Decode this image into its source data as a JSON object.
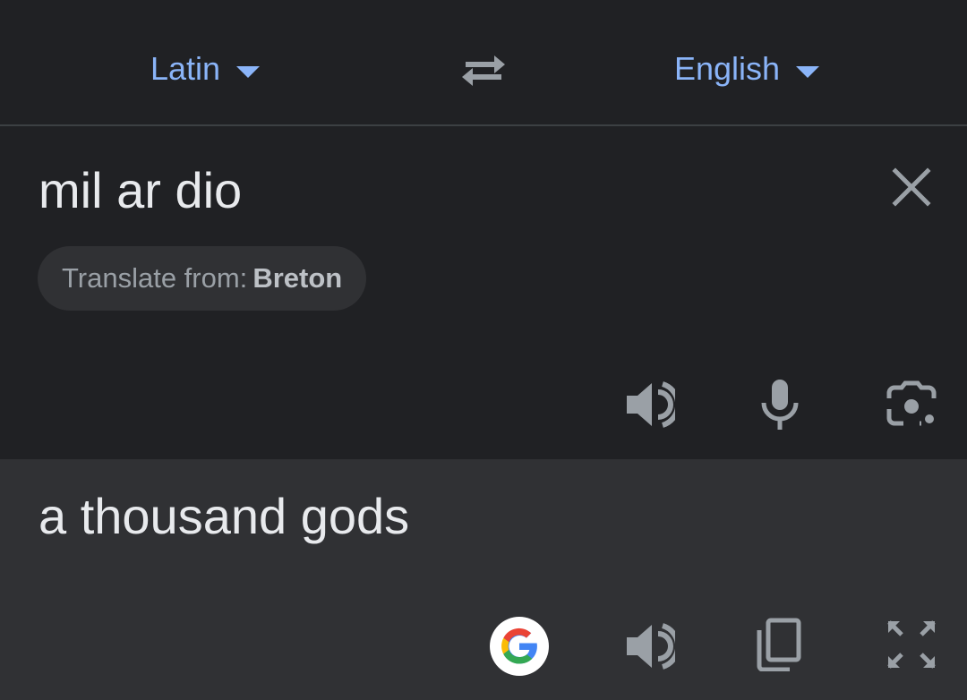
{
  "header": {
    "source_language": "Latin",
    "target_language": "English",
    "swap_icon": "swap-arrows-icon"
  },
  "input": {
    "text": "mil ar dio",
    "detect_chip": {
      "prefix": "Translate from:",
      "language": "Breton"
    },
    "actions": [
      "speaker-icon",
      "microphone-icon",
      "camera-icon"
    ]
  },
  "output": {
    "text": "a thousand gods",
    "actions": [
      "google-logo-icon",
      "speaker-icon",
      "copy-icon",
      "fullscreen-icon"
    ]
  },
  "colors": {
    "accent": "#8ab4f8",
    "background": "#202124",
    "output_background": "#303134",
    "icon": "#9aa0a6",
    "text": "#e8eaed"
  }
}
